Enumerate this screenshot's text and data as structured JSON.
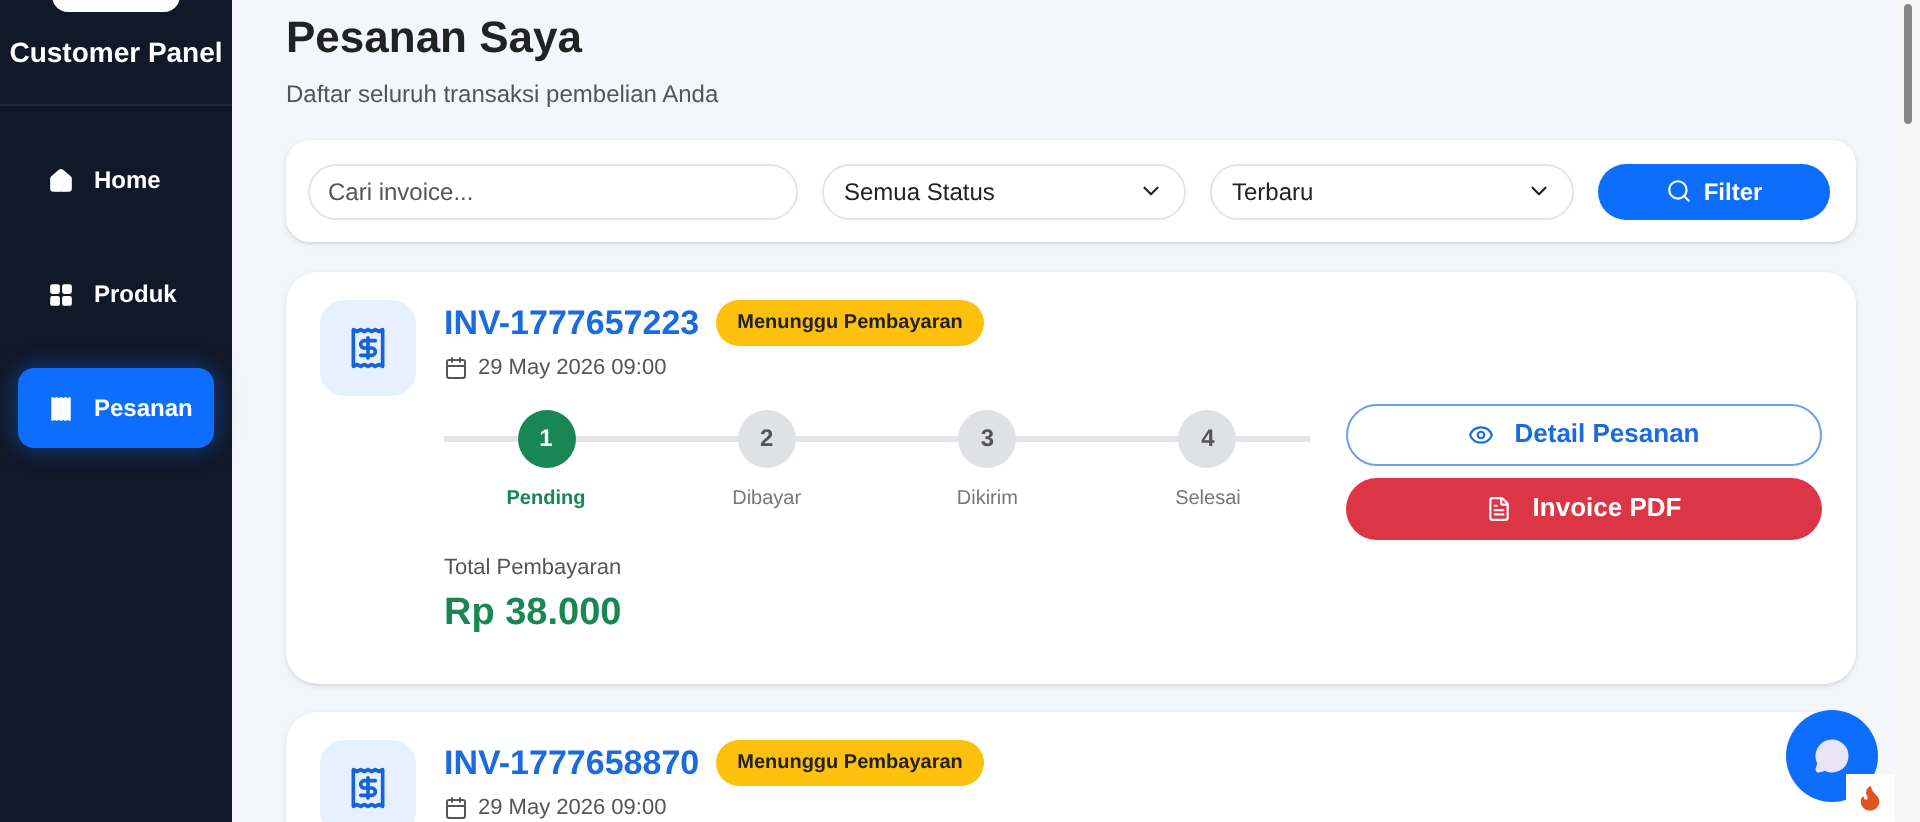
{
  "sidebar": {
    "title": "Customer Panel",
    "items": [
      {
        "label": "Home",
        "kind": "home",
        "selected": false
      },
      {
        "label": "Produk",
        "kind": "grid",
        "selected": false
      },
      {
        "label": "Pesanan",
        "kind": "receipt",
        "selected": true
      }
    ]
  },
  "header": {
    "title": "Pesanan Saya",
    "subtitle": "Daftar seluruh transaksi pembelian Anda"
  },
  "filters": {
    "search": {
      "placeholder": "Cari invoice..."
    },
    "status": "Semua Status",
    "sort": "Terbaru",
    "button": "Filter"
  },
  "orders": [
    {
      "invoice": "INV-1777657223",
      "badge": "Menunggu Pembayaran",
      "date": "29 May 2026 09:00",
      "steps": [
        {
          "number": "1",
          "label": "Pending",
          "active": true
        },
        {
          "number": "2",
          "label": "Dibayar",
          "active": false
        },
        {
          "number": "3",
          "label": "Dikirim",
          "active": false
        },
        {
          "number": "4",
          "label": "Selesai",
          "active": false
        }
      ],
      "total_label": "Total Pembayaran",
      "total": "Rp 38.000",
      "buttons": [
        {
          "kind": "outline",
          "label": "Detail Pesanan"
        },
        {
          "kind": "danger",
          "label": "Invoice PDF"
        }
      ]
    },
    {
      "invoice": "INV-1777658870",
      "badge": "Menunggu Pembayaran",
      "date": "29 May 2026 09:00"
    }
  ]
}
